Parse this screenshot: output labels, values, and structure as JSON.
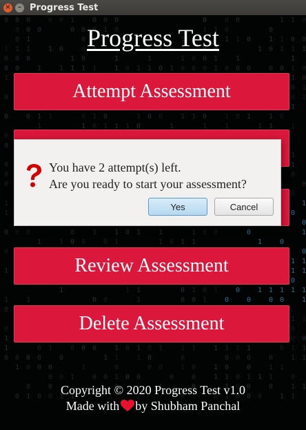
{
  "window": {
    "title": "Progress Test"
  },
  "app": {
    "heading": "Progress Test",
    "buttons": {
      "attempt": "Attempt Assessment",
      "review": "Review Assessment",
      "delete": "Delete Assessment"
    },
    "footer": {
      "copyright": "Copyright © 2020 Progress Test v1.0",
      "made_with": "Made with",
      "by": "by Shubham Panchal"
    }
  },
  "dialog": {
    "line1": "You have 2 attempt(s) left.",
    "line2": "Are you ready to start your assessment?",
    "yes_label": "Yes",
    "cancel_label": "Cancel"
  },
  "colors": {
    "accent": "#dc173c",
    "heart": "#e8112d",
    "question": "#d40000"
  }
}
